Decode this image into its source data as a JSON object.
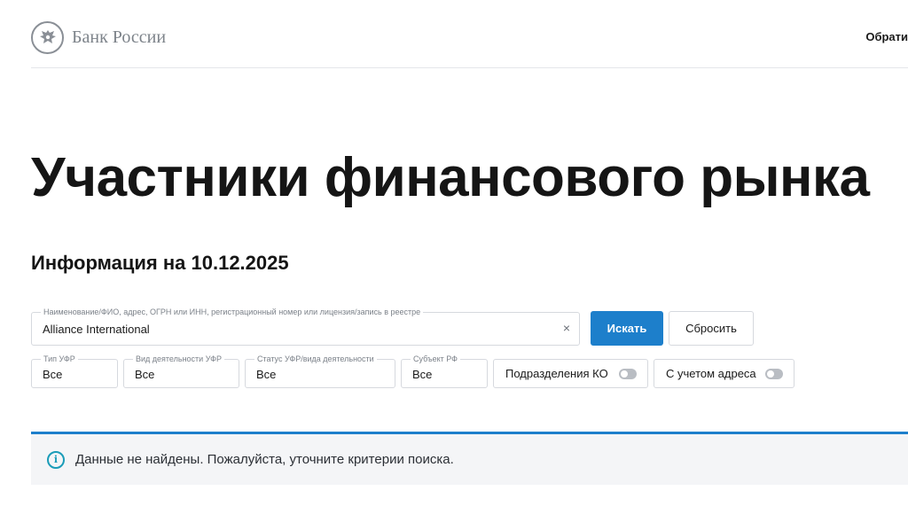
{
  "header": {
    "logo_text": "Банк России",
    "right_link": "Обрати"
  },
  "page": {
    "title": "Участники финансового рынка",
    "subtitle": "Информация на 10.12.2025"
  },
  "search": {
    "label": "Наименование/ФИО, адрес, ОГРН или ИНН, регистрационный номер или лицензия/запись в реестре",
    "value": "Alliance International",
    "clear_symbol": "×",
    "submit_label": "Искать",
    "reset_label": "Сбросить"
  },
  "filters": [
    {
      "label": "Тип УФР",
      "value": "Все"
    },
    {
      "label": "Вид деятельности УФР",
      "value": "Все"
    },
    {
      "label": "Статус УФР/вида деятельности",
      "value": "Все"
    },
    {
      "label": "Субъект РФ",
      "value": "Все"
    }
  ],
  "toggles": [
    {
      "label": "Подразделения КО",
      "on": false
    },
    {
      "label": "С учетом адреса",
      "on": false
    }
  ],
  "alert": {
    "icon": "info-icon",
    "message": "Данные не найдены. Пожалуйста, уточните критерии поиска."
  },
  "colors": {
    "primary": "#1d7fcb",
    "info": "#1a9cb8"
  }
}
